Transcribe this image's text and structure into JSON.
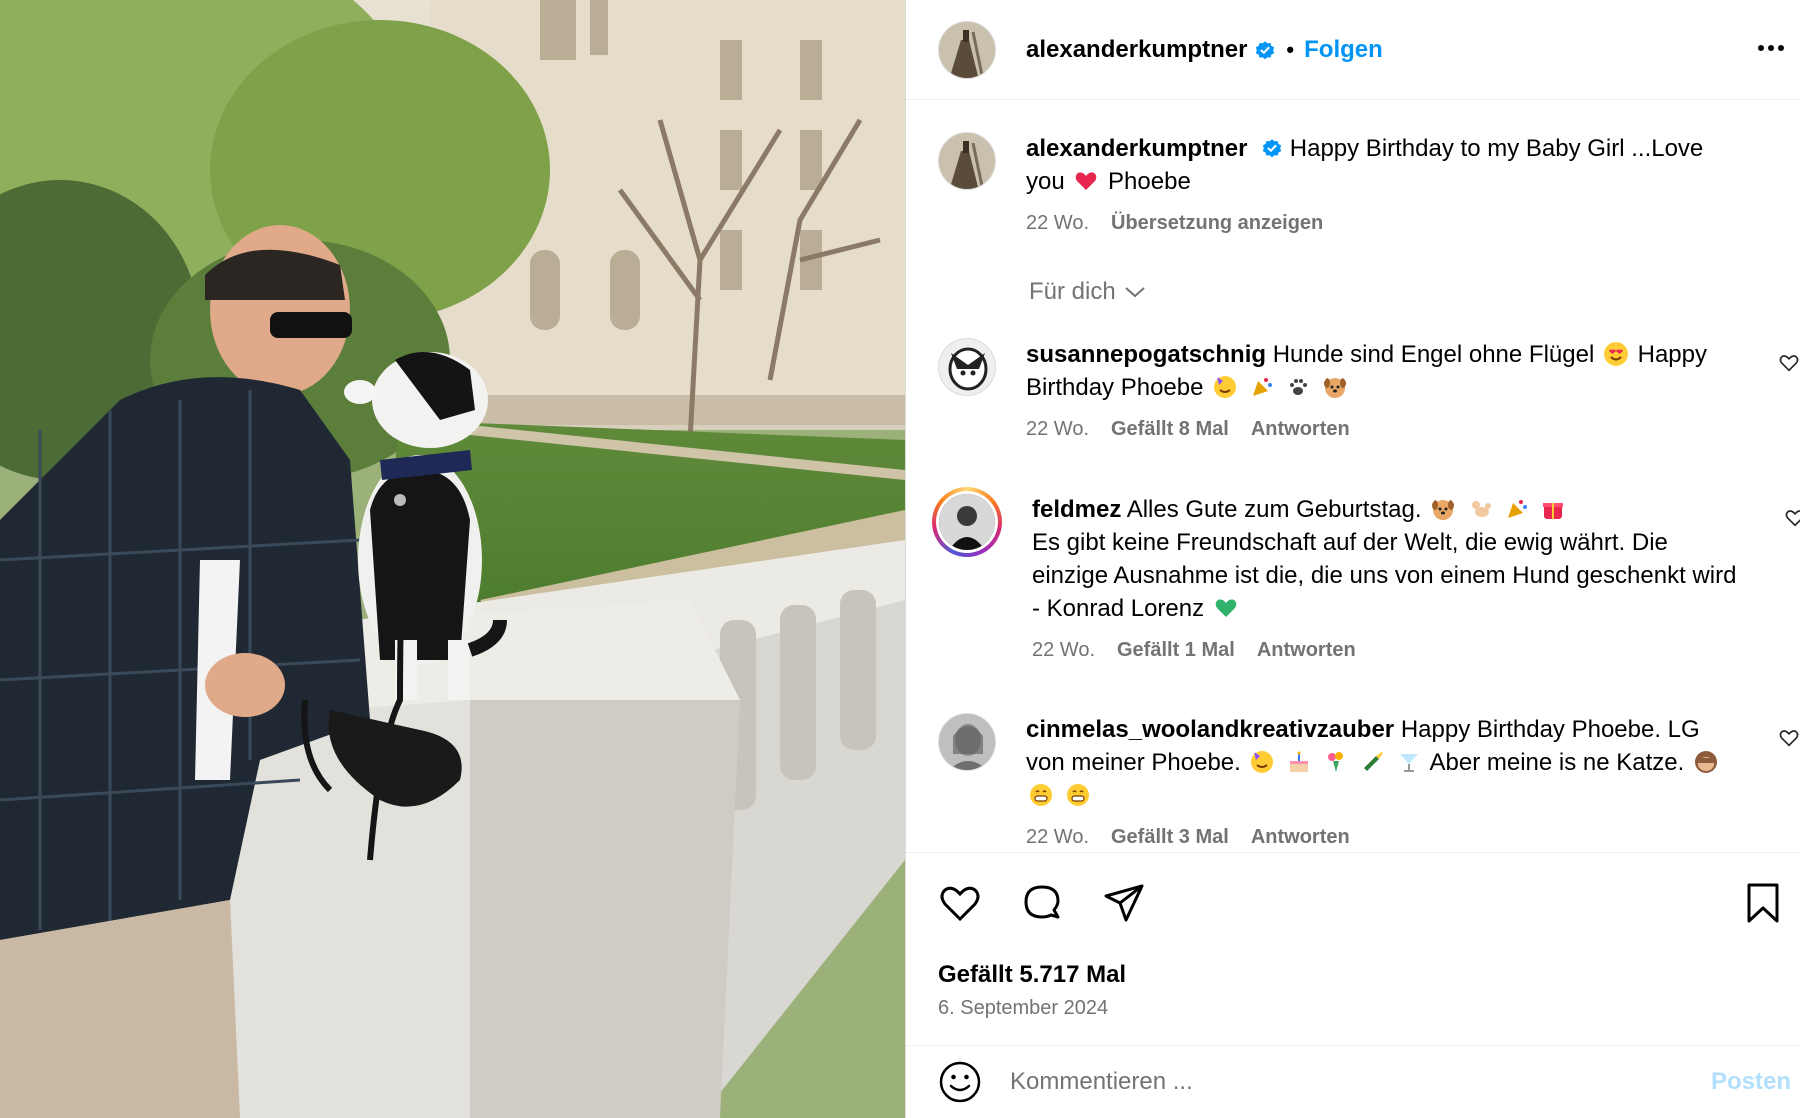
{
  "post": {
    "author": "alexanderkumptner",
    "follow_label": "Folgen",
    "separator": "•",
    "caption": {
      "username": "alexanderkumptner",
      "text_before_emoji": "Happy Birthday to my Baby Girl ...Love you",
      "text_after_emoji": "Phoebe",
      "emoji": "red-heart",
      "age": "22 Wo.",
      "translate": "Übersetzung anzeigen"
    },
    "filter_label": "Für dich",
    "comments": [
      {
        "username": "susannepogatschnig",
        "text_1": "Hunde sind Engel ohne Flügel",
        "text_2": "Happy",
        "text_3": "Birthday Phoebe",
        "age": "22 Wo.",
        "likes": "Gefällt 8 Mal",
        "reply": "Antworten"
      },
      {
        "username": "feldmez",
        "text_1": "Alles Gute zum Geburtstag.",
        "text_2": "Es gibt keine Freundschaft auf der Welt, die ewig währt. Die einzige Ausnahme ist die, die uns von einem Hund geschenkt wird - Konrad Lorenz",
        "age": "22 Wo.",
        "likes": "Gefällt 1 Mal",
        "reply": "Antworten"
      },
      {
        "username": "cinmelas_woolandkreativzauber",
        "text_1": "Happy Birthday Phoebe. LG von meiner Phoebe.",
        "text_2": "Aber meine is ne Katze.",
        "age": "22 Wo.",
        "likes": "Gefällt 3 Mal",
        "reply": "Antworten"
      }
    ],
    "likes_total": "Gefällt 5.717 Mal",
    "date": "6. September 2024",
    "comment_placeholder": "Kommentieren ...",
    "post_button": "Posten"
  },
  "colors": {
    "link_blue": "#0095f6",
    "muted": "#737373",
    "post_disabled": "#b2dffc",
    "heart_red": "#e8264f",
    "green_heart": "#2fb36b"
  },
  "icons": [
    "verified-badge-icon",
    "more-options-icon",
    "heart-icon",
    "comment-icon",
    "share-icon",
    "bookmark-icon",
    "emoji-icon",
    "chevron-down-icon"
  ]
}
